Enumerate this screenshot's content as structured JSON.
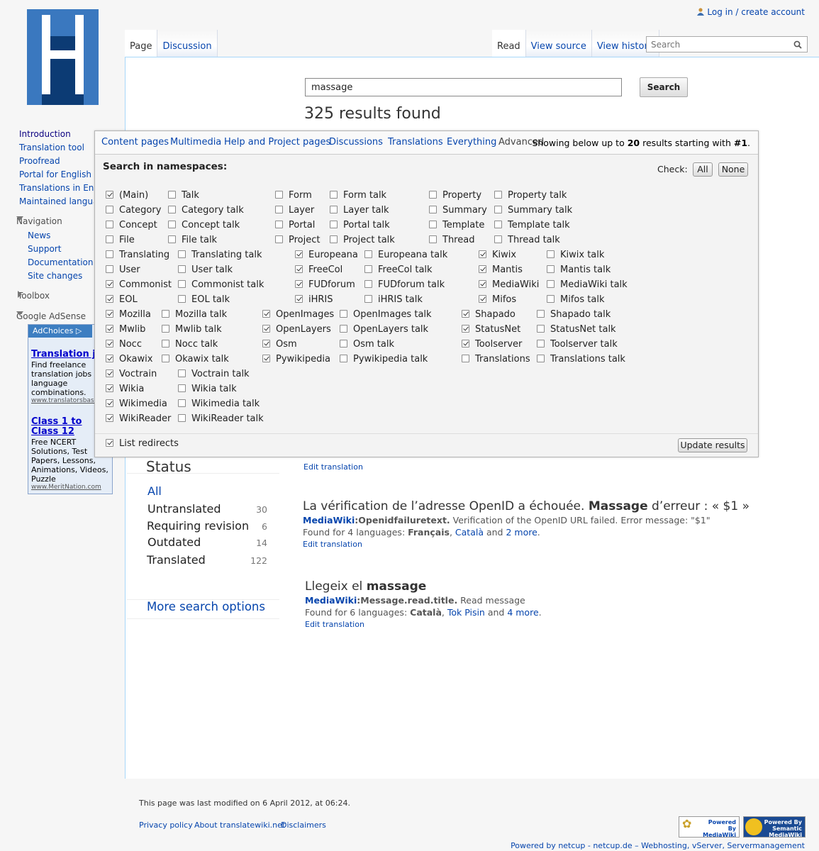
{
  "personal": {
    "login_label": "Log in / create account"
  },
  "tabs_left": [
    "Page",
    "Discussion"
  ],
  "tabs_right": [
    "Read",
    "View source",
    "View history"
  ],
  "top_search": {
    "placeholder": "Search"
  },
  "sidebar": {
    "main_links": [
      "Introduction",
      "Translation tool",
      "Proofread",
      "Portal for English",
      "Translations in English",
      "Maintained languages"
    ],
    "navigation_heading": "Navigation",
    "navigation_links": [
      "News",
      "Support",
      "Documentation",
      "Site changes"
    ],
    "toolbox_heading": "Toolbox",
    "adsense_heading": "Google AdSense"
  },
  "ads": {
    "adchoices": "AdChoices",
    "ad1_title": "Translation jobs",
    "ad1_body": "Find freelance translation jobs all language combinations.",
    "ad1_url": "www.translatorsbase.com",
    "ad2_title": "Class 1 to Class 12",
    "ad2_body": "Free NCERT Solutions, Test Papers, Lessons, Animations, Videos, Puzzle",
    "ad2_url": "www.MeritNation.com"
  },
  "search": {
    "query": "massage",
    "button": "Search",
    "results_count": "325 results found"
  },
  "advanced": {
    "tabs": [
      "Content pages",
      "Multimedia",
      "Help and Project pages",
      "Discussions",
      "Translations",
      "Everything",
      "Advanced"
    ],
    "showing_pre": "Showing below up to ",
    "showing_limit": "20",
    "showing_mid": " results starting with ",
    "showing_offset": "#1",
    "showing_post": ".",
    "ns_title": "Search in namespaces:",
    "check_label": "Check:",
    "all_btn": "All",
    "none_btn": "None",
    "list_redirects": "List redirects",
    "list_redirects_checked": true,
    "update_btn": "Update results",
    "namespaces": [
      {
        "label": "(Main)",
        "checked": true
      },
      {
        "label": "Talk",
        "checked": false
      },
      {
        "label": "Form",
        "checked": false
      },
      {
        "label": "Form talk",
        "checked": false
      },
      {
        "label": "Property",
        "checked": false
      },
      {
        "label": "Property talk",
        "checked": false
      },
      {
        "label": "Category",
        "checked": false
      },
      {
        "label": "Category talk",
        "checked": false
      },
      {
        "label": "Layer",
        "checked": false
      },
      {
        "label": "Layer talk",
        "checked": false
      },
      {
        "label": "Summary",
        "checked": false
      },
      {
        "label": "Summary talk",
        "checked": false
      },
      {
        "label": "Concept",
        "checked": false
      },
      {
        "label": "Concept talk",
        "checked": false
      },
      {
        "label": "Portal",
        "checked": false
      },
      {
        "label": "Portal talk",
        "checked": false
      },
      {
        "label": "Template",
        "checked": false
      },
      {
        "label": "Template talk",
        "checked": false
      },
      {
        "label": "File",
        "checked": false
      },
      {
        "label": "File talk",
        "checked": false
      },
      {
        "label": "Project",
        "checked": false
      },
      {
        "label": "Project talk",
        "checked": false
      },
      {
        "label": "Thread",
        "checked": false
      },
      {
        "label": "Thread talk",
        "checked": false
      },
      {
        "label": "Translating",
        "checked": false
      },
      {
        "label": "Translating talk",
        "checked": false
      },
      {
        "label": "Europeana",
        "checked": true
      },
      {
        "label": "Europeana talk",
        "checked": false
      },
      {
        "label": "Kiwix",
        "checked": true
      },
      {
        "label": "Kiwix talk",
        "checked": false
      },
      {
        "label": "User",
        "checked": false
      },
      {
        "label": "User talk",
        "checked": false
      },
      {
        "label": "FreeCol",
        "checked": true
      },
      {
        "label": "FreeCol talk",
        "checked": false
      },
      {
        "label": "Mantis",
        "checked": true
      },
      {
        "label": "Mantis talk",
        "checked": false
      },
      {
        "label": "Commonist",
        "checked": true
      },
      {
        "label": "Commonist talk",
        "checked": false
      },
      {
        "label": "FUDforum",
        "checked": true
      },
      {
        "label": "FUDforum talk",
        "checked": false
      },
      {
        "label": "MediaWiki",
        "checked": true
      },
      {
        "label": "MediaWiki talk",
        "checked": false
      },
      {
        "label": "EOL",
        "checked": true
      },
      {
        "label": "EOL talk",
        "checked": false
      },
      {
        "label": "iHRIS",
        "checked": true
      },
      {
        "label": "iHRIS talk",
        "checked": false
      },
      {
        "label": "Mifos",
        "checked": true
      },
      {
        "label": "Mifos talk",
        "checked": false
      },
      {
        "label": "Mozilla",
        "checked": true
      },
      {
        "label": "Mozilla talk",
        "checked": false
      },
      {
        "label": "OpenImages",
        "checked": true
      },
      {
        "label": "OpenImages talk",
        "checked": false
      },
      {
        "label": "Shapado",
        "checked": true
      },
      {
        "label": "Shapado talk",
        "checked": false
      },
      {
        "label": "Mwlib",
        "checked": true
      },
      {
        "label": "Mwlib talk",
        "checked": false
      },
      {
        "label": "OpenLayers",
        "checked": true
      },
      {
        "label": "OpenLayers talk",
        "checked": false
      },
      {
        "label": "StatusNet",
        "checked": true
      },
      {
        "label": "StatusNet talk",
        "checked": false
      },
      {
        "label": "Nocc",
        "checked": true
      },
      {
        "label": "Nocc talk",
        "checked": false
      },
      {
        "label": "Osm",
        "checked": true
      },
      {
        "label": "Osm talk",
        "checked": false
      },
      {
        "label": "Toolserver",
        "checked": true
      },
      {
        "label": "Toolserver talk",
        "checked": false
      },
      {
        "label": "Okawix",
        "checked": true
      },
      {
        "label": "Okawix talk",
        "checked": false
      },
      {
        "label": "Pywikipedia",
        "checked": true
      },
      {
        "label": "Pywikipedia talk",
        "checked": false
      },
      {
        "label": "Translations",
        "checked": false
      },
      {
        "label": "Translations talk",
        "checked": false
      },
      {
        "label": "Voctrain",
        "checked": true
      },
      {
        "label": "Voctrain talk",
        "checked": false
      },
      {
        "label": "Wikia",
        "checked": true
      },
      {
        "label": "Wikia talk",
        "checked": false
      },
      {
        "label": "Wikimedia",
        "checked": true
      },
      {
        "label": "Wikimedia talk",
        "checked": false
      },
      {
        "label": "WikiReader",
        "checked": true
      },
      {
        "label": "WikiReader talk",
        "checked": false
      }
    ]
  },
  "status": {
    "heading": "Status",
    "all": "All",
    "items": [
      {
        "label": "Untranslated",
        "count": "30"
      },
      {
        "label": "Requiring revision",
        "count": "6"
      },
      {
        "label": "Outdated",
        "count": "14"
      },
      {
        "label": "Translated",
        "count": "122"
      }
    ],
    "more_options": "More search options"
  },
  "results": {
    "edit_label": "Edit translation",
    "r1": {
      "title_pre": "La vérification de l’adresse OpenID a échouée. ",
      "title_bold": "Massage",
      "title_post": " d’erreur : « $1 »",
      "ns": "MediaWiki",
      "page": ":Openidfailuretext.",
      "desc": " Verification of the OpenID URL failed. Error message: \"$1\"",
      "found_pre": "Found for 4 languages: ",
      "lang1": "Français",
      "lang2": "Català",
      "and": " and ",
      "more": "2 more",
      "dot": "."
    },
    "r2": {
      "title_pre": "Llegeix el ",
      "title_bold": "massage",
      "ns": "MediaWiki",
      "page": ":Message.read.title.",
      "desc": " Read message",
      "found_pre": "Found for 6 languages: ",
      "lang1": "Català",
      "lang2": "Tok Pisin",
      "and": " and ",
      "more": "4 more",
      "dot": "."
    }
  },
  "footer": {
    "modified": "This page was last modified on 6 April 2012, at 06:24.",
    "links": [
      "Privacy policy",
      "About translatewiki.net",
      "Disclaimers"
    ],
    "badge1": "Powered By MediaWiki",
    "badge2": "Powered By Semantic MediaWiki",
    "powered": "Powered by netcup - netcup.de – Webhosting, vServer, Servermanagement"
  }
}
